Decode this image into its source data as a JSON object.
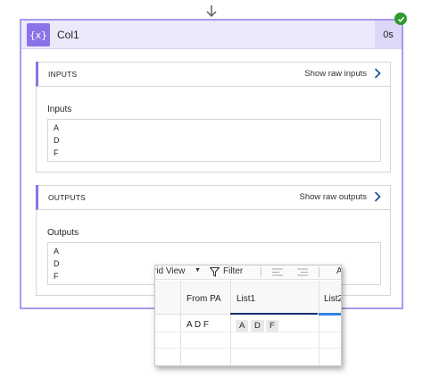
{
  "action": {
    "title": "Col1",
    "duration": "0s",
    "icon": "expression-icon",
    "status": "succeeded",
    "status_color": "#2e9b2e",
    "accent_color": "#8c72e8"
  },
  "inputs_section": {
    "header": "INPUTS",
    "raw_link": "Show raw inputs",
    "field_label": "Inputs",
    "values": [
      "A",
      "D",
      "F"
    ]
  },
  "outputs_section": {
    "header": "OUTPUTS",
    "raw_link": "Show raw outputs",
    "field_label": "Outputs",
    "values": [
      "A",
      "D",
      "F"
    ]
  },
  "grid": {
    "toolbar": {
      "view_label": "rid View",
      "filter_label": "Filter",
      "extra_label": "A"
    },
    "columns": [
      "From PA",
      "List1",
      "List2"
    ],
    "rows": [
      {
        "from_pa": "A D F",
        "list1_tags": [
          "A",
          "D",
          "F"
        ]
      }
    ]
  }
}
